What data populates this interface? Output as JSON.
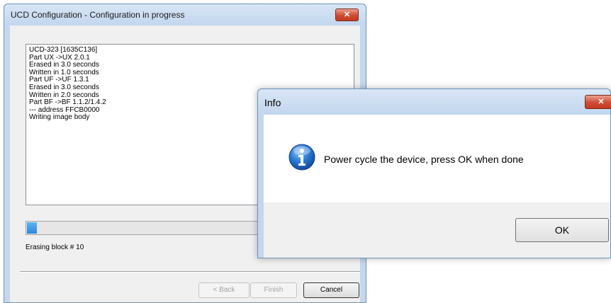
{
  "main_window": {
    "title": "UCD Configuration - Configuration in progress",
    "close_glyph": "✕",
    "log_lines": [
      "UCD-323 [1635C136]",
      "Part UX ->UX 2.0.1",
      "Erased in 3.0 seconds",
      "Written in 1.0 seconds",
      "Part UF ->UF 1.3.1",
      "Erased in 3.0 seconds",
      "Written in 2.0 seconds",
      "Part BF ->BF 1.1.2/1.4.2",
      "--- address FFCB0000",
      "Writing image body"
    ],
    "progress_fraction": 0.03,
    "status": "Erasing block #  10",
    "buttons": {
      "back": "< Back",
      "finish": "Finish",
      "cancel": "Cancel"
    }
  },
  "info_dialog": {
    "title": "Info",
    "close_glyph": "✕",
    "icon": "info-icon",
    "message": "Power cycle the device, press OK when done",
    "ok_label": "OK"
  },
  "colors": {
    "title_bar": "#c4d7ee",
    "close_button": "#c94a33",
    "progress_fill": "#2b87dc",
    "info_icon": "#1c67c4"
  }
}
